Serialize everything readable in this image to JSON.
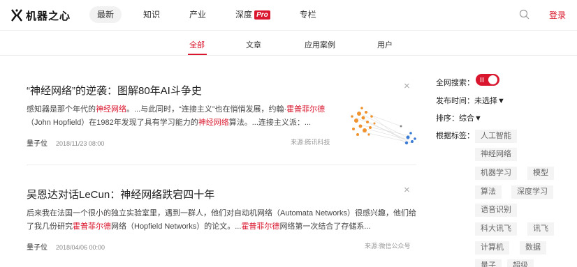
{
  "header": {
    "logo_text": "机器之心",
    "nav": [
      {
        "label": "最新",
        "active": true
      },
      {
        "label": "知识"
      },
      {
        "label": "产业"
      },
      {
        "label": "深度",
        "badge": "Pro"
      },
      {
        "label": "专栏"
      }
    ],
    "search_icon": "search-icon",
    "login_label": "登录"
  },
  "tabs": [
    {
      "label": "全部",
      "active": true
    },
    {
      "label": "文章"
    },
    {
      "label": "应用案例"
    },
    {
      "label": "用户"
    }
  ],
  "articles": [
    {
      "title": "“神经网络”的逆袭：图解80年AI斗争史",
      "summary_parts": [
        {
          "t": "感知器是那个年代的"
        },
        {
          "t": "神经网络",
          "hl": true
        },
        {
          "t": "。...与此同时，“连接主义”也在悄悄发展，约翰·"
        },
        {
          "t": "霍普菲尔德",
          "hl": true
        },
        {
          "t": "（John Hopfield）在1982年发现了具有学习能力的"
        },
        {
          "t": "神经网络",
          "hl": true
        },
        {
          "t": "算法。...连接主义派：..."
        }
      ],
      "author": "量子位",
      "date": "2018/11/23 08:00",
      "source": "来源:腾讯科技",
      "close": "×"
    },
    {
      "title": "吴恩达对话LeCun：神经网络跌宕四十年",
      "summary_parts": [
        {
          "t": "后来我在法国一个很小的独立实验室里，遇到一群人，他们对自动机网络（Automata Networks）很感兴趣，他们给了我几份研究"
        },
        {
          "t": "霍普菲尔德",
          "hl": true
        },
        {
          "t": "网络（Hopfield Networks）的论文。..."
        },
        {
          "t": "霍普菲尔德",
          "hl": true
        },
        {
          "t": "网络第一次结合了存储系..."
        }
      ],
      "author": "量子位",
      "date": "2018/04/06 00:00",
      "source": "来源:微信公众号",
      "close": "×"
    }
  ],
  "sidebar": {
    "search_label": "全网搜索：",
    "search_toggle_on": true,
    "time_label": "发布时间：",
    "time_value": "未选择▼",
    "sort_label": "排序：",
    "sort_value": "综合▼",
    "tags_label": "根据标签：",
    "tags": [
      "人工智能",
      "神经网络",
      "机器学习",
      "模型",
      "算法",
      "深度学习",
      "语音识别",
      "科大讯飞",
      "讯飞",
      "计算机",
      "数据",
      "量子",
      "超级"
    ]
  },
  "colors": {
    "accent": "#d9162d",
    "active_nav_bg": "#f2f2f2",
    "tag_bg": "#f4f4f4"
  }
}
